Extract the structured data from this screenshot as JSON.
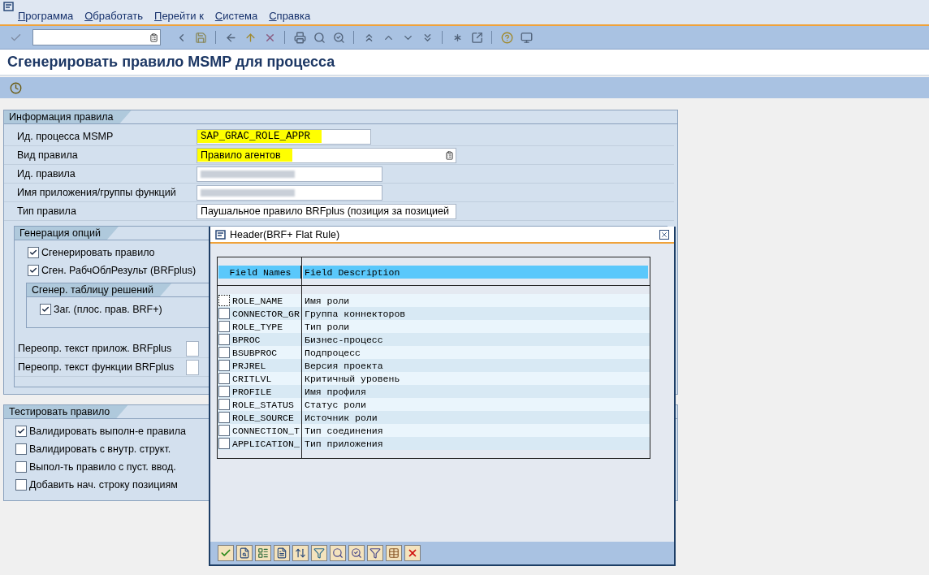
{
  "menu": [
    "Программа",
    "Обработать",
    "Перейти к",
    "Система",
    "Справка"
  ],
  "page_title": "Сгенерировать правило MSMP для процесса",
  "rule_info": {
    "title": "Информация правила",
    "fields": [
      {
        "label": "Ид. процесса MSMP",
        "kind": "text",
        "value": "SAP_GRAC_ROLE_APPR",
        "highlighted": true
      },
      {
        "label": "Вид правила",
        "kind": "dropdown",
        "value": "Правило агентов",
        "highlighted": true
      },
      {
        "label": "Ид. правила",
        "kind": "redacted"
      },
      {
        "label": "Имя приложения/группы функций",
        "kind": "redacted"
      },
      {
        "label": "Тип правила",
        "kind": "dropdown",
        "value": "Паушальное правило BRFplus (позиция за позицией",
        "highlighted": false
      }
    ]
  },
  "generation": {
    "title": "Генерация опций",
    "options": [
      {
        "label": "Сгенерировать правило",
        "checked": true
      },
      {
        "label": "Сген. РабчОблРезульт (BRFplus)",
        "checked": true
      }
    ],
    "decision_table": {
      "title": "Сгенер. таблицу решений",
      "options": [
        {
          "label": "Заг. (плос. прав. BRF+)",
          "checked": true
        }
      ]
    },
    "overrides": [
      {
        "label": "Переопр. текст прилож. BRFplus"
      },
      {
        "label": "Переопр. текст функции BRFplus"
      }
    ]
  },
  "test": {
    "title": "Тестировать правило",
    "options": [
      {
        "label": "Валидировать выполн-е правила",
        "checked": true
      },
      {
        "label": "Валидировать с внутр. структ.",
        "checked": false
      },
      {
        "label": "Выпол-ть правило с пуст. ввод.",
        "checked": false
      },
      {
        "label": "Добавить нач. строку позициям",
        "checked": false
      }
    ]
  },
  "dialog": {
    "title": "Header(BRF+ Flat Rule)",
    "columns": [
      "Field Names",
      "Field Description"
    ],
    "rows": [
      {
        "name": "ROLE_NAME",
        "description": "Имя роли",
        "checked": false,
        "focused": true
      },
      {
        "name": "CONNECTOR_GR",
        "description": "Группа коннекторов",
        "checked": false,
        "focused": false
      },
      {
        "name": "ROLE_TYPE",
        "description": "Тип роли",
        "checked": false,
        "focused": false
      },
      {
        "name": "BPROC",
        "description": "Бизнес-процесс",
        "checked": false,
        "focused": false
      },
      {
        "name": "BSUBPROC",
        "description": "Подпроцесс",
        "checked": false,
        "focused": false
      },
      {
        "name": "PRJREL",
        "description": "Версия проекта",
        "checked": false,
        "focused": false
      },
      {
        "name": "CRITLVL",
        "description": "Критичный уровень",
        "checked": false,
        "focused": false
      },
      {
        "name": "PROFILE",
        "description": "Имя профиля",
        "checked": false,
        "focused": false
      },
      {
        "name": "ROLE_STATUS",
        "description": "Статус роли",
        "checked": false,
        "focused": false
      },
      {
        "name": "ROLE_SOURCE",
        "description": "Источник роли",
        "checked": false,
        "focused": false
      },
      {
        "name": "CONNECTION_T",
        "description": "Тип соединения",
        "checked": false,
        "focused": false
      },
      {
        "name": "APPLICATION_",
        "description": "Тип приложения",
        "checked": false,
        "focused": false
      }
    ]
  }
}
